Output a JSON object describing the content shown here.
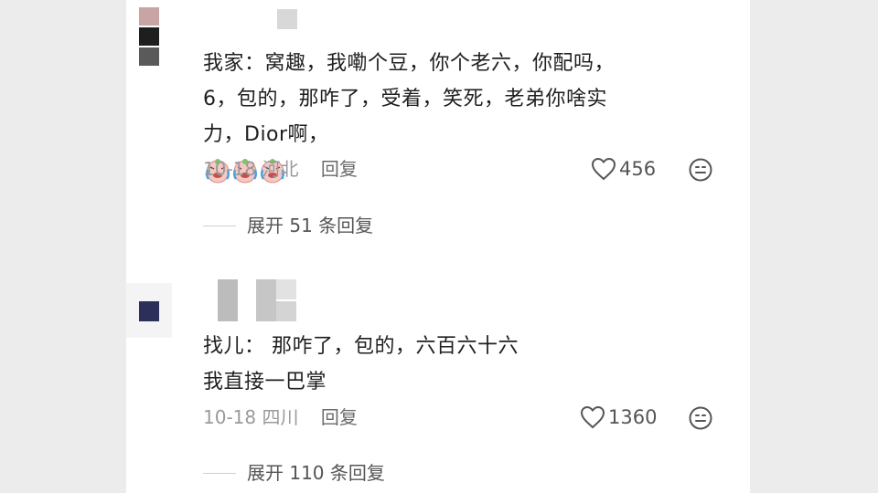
{
  "comments": [
    {
      "text_lines": [
        "我家：窝趣，我嘞个豆，你个老六，你配吗，",
        "6，包的，那咋了，受着，笑死，老弟你啥实",
        "力，Dior啊，"
      ],
      "emoji": "crying-laughing-emoji x3",
      "date": "10-18",
      "location": "河北",
      "reply_label": "回复",
      "likes": "456",
      "expand_label": "展开 51 条回复"
    },
    {
      "text_lines": [
        "找儿：  那咋了，包的，六百六十六",
        "我直接一巴掌"
      ],
      "date": "10-18",
      "location": "四川",
      "reply_label": "回复",
      "likes": "1360",
      "expand_label": "展开 110 条回复"
    }
  ],
  "colors": {
    "background": "#ececec",
    "panel": "#ffffff",
    "text": "#1f1f1f",
    "meta": "#9a9a9a",
    "avatar_navy": "#2c2f5a",
    "avatar_pink": "#c8a4a4"
  },
  "icons": [
    "heart-outline-icon",
    "emoji-face-icon",
    "crying-laughing-emoji"
  ]
}
